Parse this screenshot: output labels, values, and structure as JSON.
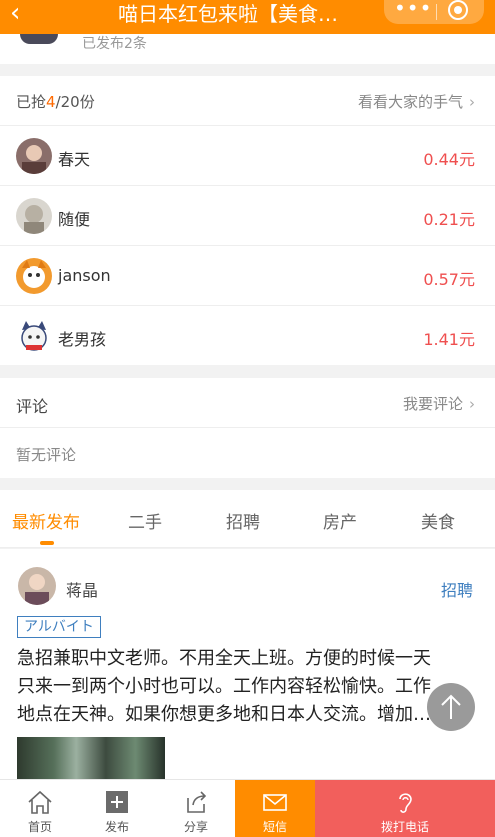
{
  "header": {
    "back_icon": "back-icon",
    "title": "喵日本红包来啦【美食…",
    "more_icon": "more-dots-icon",
    "close_icon": "target-icon"
  },
  "poster": {
    "posted_text": "已发布2条"
  },
  "grab": {
    "prefix": "已抢",
    "grabbed": "4",
    "suffix": "/20份",
    "luck_link": "看看大家的手气",
    "rows": [
      {
        "name": "春天",
        "amount": "0.44元"
      },
      {
        "name": "随便",
        "amount": "0.21元"
      },
      {
        "name": "janson",
        "amount": "0.57元"
      },
      {
        "name": "老男孩",
        "amount": "1.41元"
      }
    ]
  },
  "comments": {
    "title": "评论",
    "action": "我要评论",
    "empty": "暂无评论"
  },
  "tabs": [
    "最新发布",
    "二手",
    "招聘",
    "房产",
    "美食"
  ],
  "post": {
    "author": "蒋晶",
    "category": "招聘",
    "tag": "アルバイト",
    "lines": [
      "急招兼职中文老师。不用全天上班。方便的时候一天",
      "只来一到两个小时也可以。工作内容轻松愉快。工作",
      "地点在天神。如果你想更多地和日本人交流。增加…"
    ]
  },
  "bottom_nav": {
    "home": "首页",
    "publish": "发布",
    "share": "分享",
    "sms": "短信",
    "call": "拨打电话"
  },
  "colors": {
    "brand": "#ff8c00",
    "amount": "#ef4f4f",
    "call": "#f25f5c",
    "tag": "#3f7fbf"
  }
}
